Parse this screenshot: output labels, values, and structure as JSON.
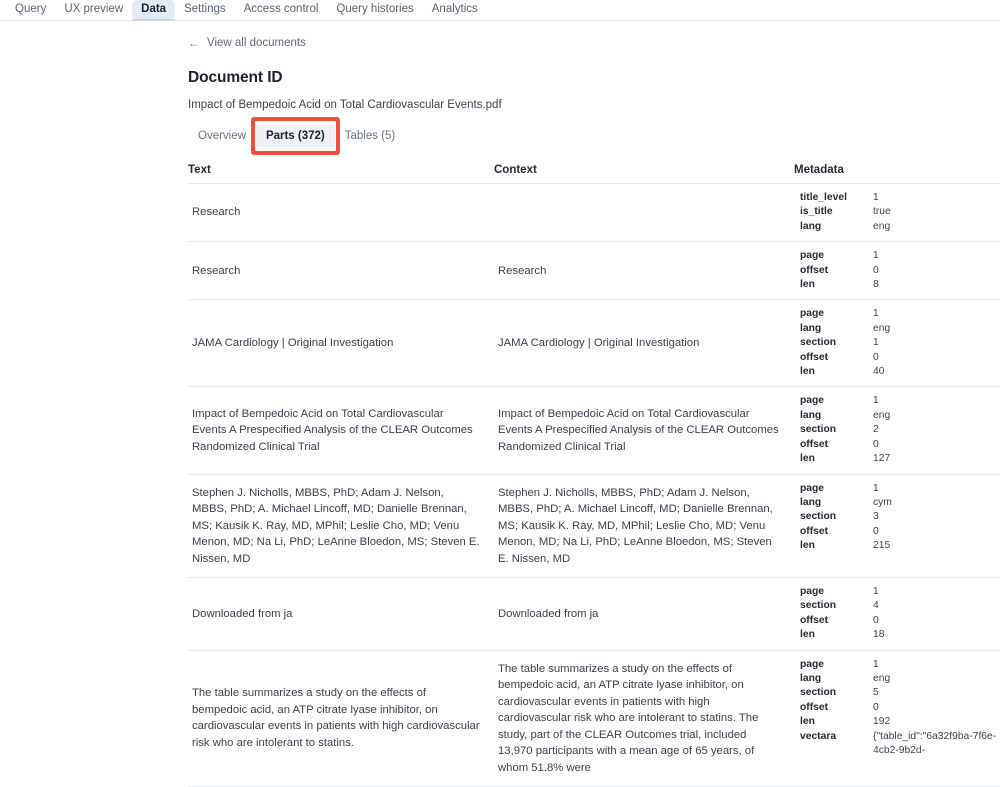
{
  "topnav": {
    "tabs": [
      {
        "label": "Query",
        "active": false
      },
      {
        "label": "UX preview",
        "active": false
      },
      {
        "label": "Data",
        "active": true
      },
      {
        "label": "Settings",
        "active": false
      },
      {
        "label": "Access control",
        "active": false
      },
      {
        "label": "Query histories",
        "active": false
      },
      {
        "label": "Analytics",
        "active": false
      }
    ]
  },
  "backlink": {
    "icon": "arrow-left-icon",
    "glyph": "←",
    "label": "View all documents"
  },
  "document": {
    "heading": "Document ID",
    "filename": "Impact of Bempedoic Acid on Total Cardiovascular Events.pdf"
  },
  "doctabs": {
    "tabs": [
      {
        "label": "Overview",
        "active": false
      },
      {
        "label": "Parts (372)",
        "active": true
      },
      {
        "label": "Tables (5)",
        "active": false
      }
    ],
    "annotation_color": "#f2503c"
  },
  "table": {
    "headers": [
      "Text",
      "Context",
      "Metadata"
    ],
    "rows": [
      {
        "text": "Research",
        "context": "",
        "metadata": [
          {
            "key": "title_level",
            "value": "1"
          },
          {
            "key": "is_title",
            "value": "true"
          },
          {
            "key": "lang",
            "value": "eng"
          }
        ]
      },
      {
        "text": "Research",
        "context": "Research",
        "metadata": [
          {
            "key": "page",
            "value": "1"
          },
          {
            "key": "offset",
            "value": "0"
          },
          {
            "key": "len",
            "value": "8"
          }
        ]
      },
      {
        "text": "JAMA Cardiology | Original Investigation",
        "context": "JAMA Cardiology | Original Investigation",
        "metadata": [
          {
            "key": "page",
            "value": "1"
          },
          {
            "key": "lang",
            "value": "eng"
          },
          {
            "key": "section",
            "value": "1"
          },
          {
            "key": "offset",
            "value": "0"
          },
          {
            "key": "len",
            "value": "40"
          }
        ]
      },
      {
        "text": "Impact of Bempedoic Acid on Total Cardiovascular Events A Prespecified Analysis of the CLEAR Outcomes Randomized Clinical Trial",
        "context": "Impact of Bempedoic Acid on Total Cardiovascular Events A Prespecified Analysis of the CLEAR Outcomes Randomized Clinical Trial",
        "metadata": [
          {
            "key": "page",
            "value": "1"
          },
          {
            "key": "lang",
            "value": "eng"
          },
          {
            "key": "section",
            "value": "2"
          },
          {
            "key": "offset",
            "value": "0"
          },
          {
            "key": "len",
            "value": "127"
          }
        ]
      },
      {
        "text": "Stephen J. Nicholls, MBBS, PhD; Adam J. Nelson, MBBS, PhD; A. Michael Lincoff, MD; Danielle Brennan, MS; Kausik K. Ray, MD, MPhil; Leslie Cho, MD; Venu Menon, MD; Na Li, PhD; LeAnne Bloedon, MS; Steven E. Nissen, MD",
        "context": "Stephen J. Nicholls, MBBS, PhD; Adam J. Nelson, MBBS, PhD; A. Michael Lincoff, MD; Danielle Brennan, MS; Kausik K. Ray, MD, MPhil; Leslie Cho, MD; Venu Menon, MD; Na Li, PhD; LeAnne Bloedon, MS; Steven E. Nissen, MD",
        "metadata": [
          {
            "key": "page",
            "value": "1"
          },
          {
            "key": "lang",
            "value": "cym"
          },
          {
            "key": "section",
            "value": "3"
          },
          {
            "key": "offset",
            "value": "0"
          },
          {
            "key": "len",
            "value": "215"
          }
        ]
      },
      {
        "text": "Downloaded from ja",
        "context": "Downloaded from ja",
        "metadata": [
          {
            "key": "page",
            "value": "1"
          },
          {
            "key": "section",
            "value": "4"
          },
          {
            "key": "offset",
            "value": "0"
          },
          {
            "key": "len",
            "value": "18"
          }
        ]
      },
      {
        "text": "The table summarizes a study on the effects of bempedoic acid, an ATP citrate lyase inhibitor, on cardiovascular events in patients with high cardiovascular risk who are intolerant to statins.",
        "context": "The table summarizes a study on the effects of bempedoic acid, an ATP citrate lyase inhibitor, on cardiovascular events in patients with high cardiovascular risk who are intolerant to statins. The study, part of the CLEAR Outcomes trial, included 13,970 participants with a mean age of 65 years, of whom 51.8% were",
        "metadata": [
          {
            "key": "page",
            "value": "1"
          },
          {
            "key": "lang",
            "value": "eng"
          },
          {
            "key": "section",
            "value": "5"
          },
          {
            "key": "offset",
            "value": "0"
          },
          {
            "key": "len",
            "value": "192"
          },
          {
            "key": "vectara",
            "value": "{\"table_id\":\"6a32f9ba-7f6e-4cb2-9b2d-"
          }
        ]
      }
    ]
  }
}
